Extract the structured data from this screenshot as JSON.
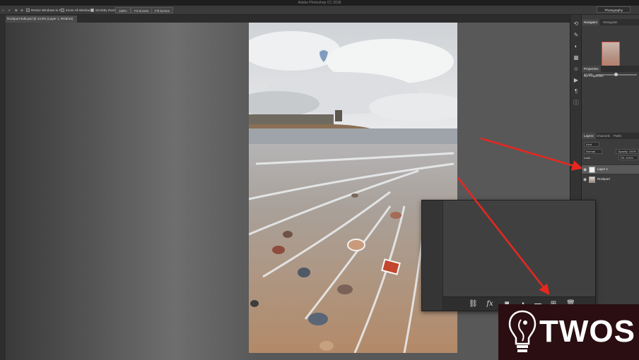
{
  "window": {
    "title": "Adobe Photoshop CC 2018"
  },
  "options_bar": {
    "resize_windows_label": "Resize Windows to Fit",
    "zoom_all_windows_label": "Zoom All Windows",
    "scrubby_zoom_label": "Scrubby Zoom",
    "zoom_100_label": "100%",
    "fit_screen_label": "Fit Screen",
    "fill_screen_label": "Fill Screen",
    "workspace_label": "Photography"
  },
  "document": {
    "tab_label": "Rockport-Edit.psd @ 44.8% (Layer 1, RGB/16)"
  },
  "panels": {
    "navigator_tab": "Navigator",
    "histogram_tab": "Histogram",
    "zoom_value": "44.8%",
    "properties_tab": "Properties",
    "no_properties": "No Properties",
    "layers_tab": "Layers",
    "channels_tab": "Channels",
    "paths_tab": "Paths",
    "kind_label": "Kind",
    "blend_mode": "Normal",
    "opacity_label": "Opacity: 100%",
    "lock_label": "Lock:",
    "fill_label": "Fill: 100%",
    "layers": [
      {
        "name": "Layer 1",
        "selected": true
      },
      {
        "name": "Rockport",
        "selected": false
      }
    ]
  },
  "watermark": {
    "brand": "TWOS"
  },
  "colors": {
    "arrow": "#e8271f",
    "logo_bg": "#2a0e12",
    "selected_layer": "#595959"
  },
  "icons": {
    "zoom_footer": [
      "link-icon",
      "fx-icon",
      "mask-icon",
      "adjustment-icon",
      "group-folder-icon",
      "new-layer-icon",
      "trash-icon"
    ]
  }
}
